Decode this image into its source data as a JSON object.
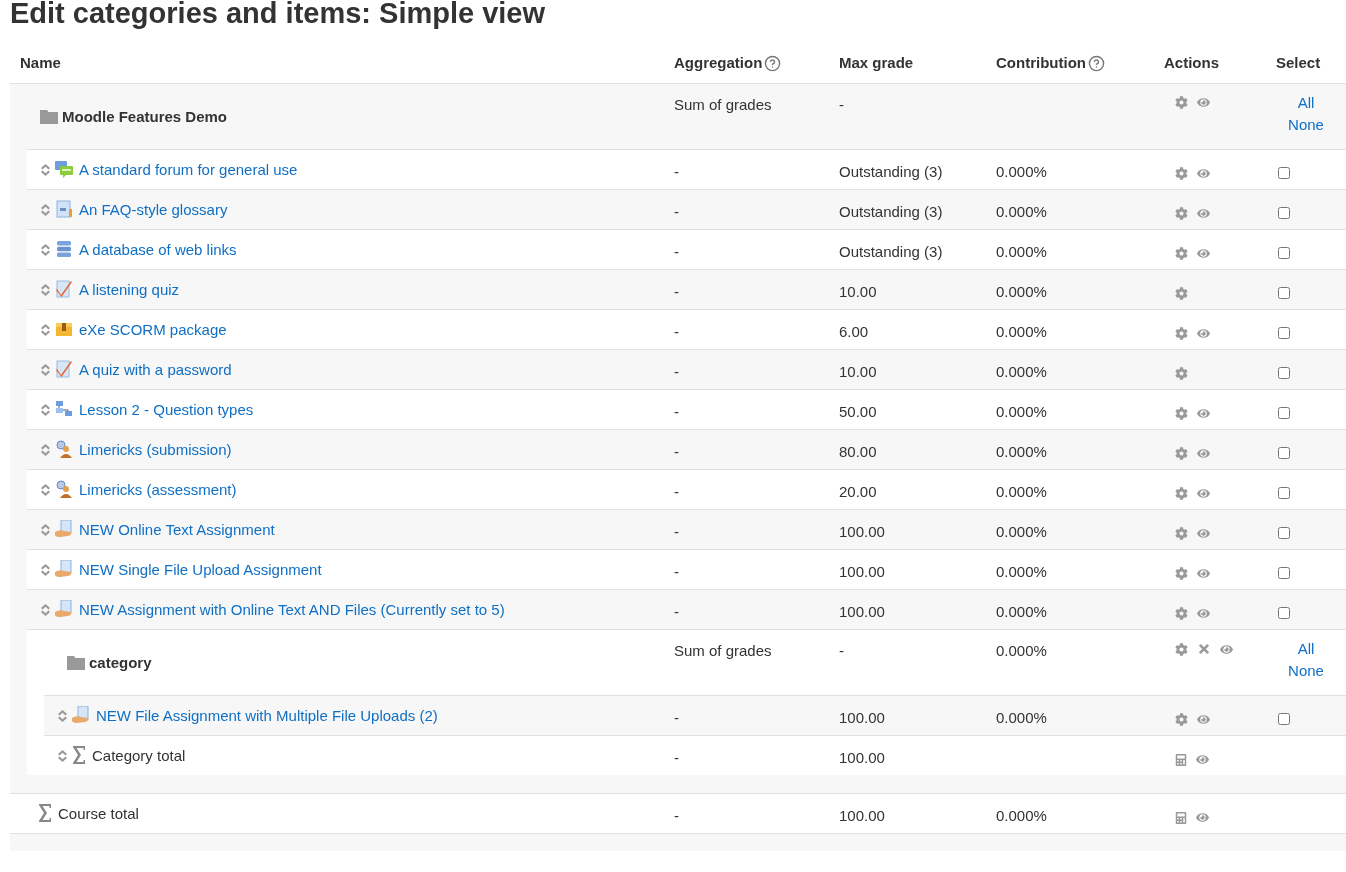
{
  "title": "Edit categories and items: Simple view",
  "columns": [
    {
      "label": "Name",
      "help": false
    },
    {
      "label": "Aggregation",
      "help": true
    },
    {
      "label": "Max grade",
      "help": false
    },
    {
      "label": "Contribution",
      "help": true
    },
    {
      "label": "Actions",
      "help": false
    },
    {
      "label": "Select",
      "help": false
    }
  ],
  "rows": [
    {
      "kind": "category",
      "name": "Moodle Features Demo",
      "aggregation": "Sum of grades",
      "max_grade": "-",
      "actions": [
        {
          "kind": "edit"
        },
        {
          "kind": "show"
        }
      ],
      "select": [
        "All",
        "None"
      ],
      "children": [
        {
          "kind": "item",
          "icon": {
            "kind": "forum"
          },
          "name": "A standard forum for general use",
          "aggregation": "-",
          "max_grade": "Outstanding (3)",
          "contribution": "0.000%",
          "actions": [
            {
              "kind": "edit"
            },
            {
              "kind": "show"
            }
          ],
          "checked": false
        },
        {
          "kind": "item",
          "icon": {
            "kind": "glossary"
          },
          "name": "An FAQ-style glossary",
          "aggregation": "-",
          "max_grade": "Outstanding (3)",
          "contribution": "0.000%",
          "actions": [
            {
              "kind": "edit"
            },
            {
              "kind": "show"
            }
          ],
          "checked": false
        },
        {
          "kind": "item",
          "icon": {
            "kind": "database"
          },
          "name": "A database of web links",
          "aggregation": "-",
          "max_grade": "Outstanding (3)",
          "contribution": "0.000%",
          "actions": [
            {
              "kind": "edit"
            },
            {
              "kind": "show"
            }
          ],
          "checked": false
        },
        {
          "kind": "item",
          "icon": {
            "kind": "quiz"
          },
          "name": "A listening quiz",
          "aggregation": "-",
          "max_grade": "10.00",
          "contribution": "0.000%",
          "actions": [
            {
              "kind": "edit"
            }
          ],
          "checked": false
        },
        {
          "kind": "item",
          "icon": {
            "kind": "scorm"
          },
          "name": "eXe SCORM package",
          "aggregation": "-",
          "max_grade": "6.00",
          "contribution": "0.000%",
          "actions": [
            {
              "kind": "edit"
            },
            {
              "kind": "show"
            }
          ],
          "checked": false
        },
        {
          "kind": "item",
          "icon": {
            "kind": "quiz"
          },
          "name": "A quiz with a password",
          "aggregation": "-",
          "max_grade": "10.00",
          "contribution": "0.000%",
          "actions": [
            {
              "kind": "edit"
            }
          ],
          "checked": false
        },
        {
          "kind": "item",
          "icon": {
            "kind": "lesson"
          },
          "name": "Lesson 2 - Question types",
          "aggregation": "-",
          "max_grade": "50.00",
          "contribution": "0.000%",
          "actions": [
            {
              "kind": "edit"
            },
            {
              "kind": "show"
            }
          ],
          "checked": false
        },
        {
          "kind": "item",
          "icon": {
            "kind": "workshop"
          },
          "name": "Limericks (submission)",
          "aggregation": "-",
          "max_grade": "80.00",
          "contribution": "0.000%",
          "actions": [
            {
              "kind": "edit"
            },
            {
              "kind": "show"
            }
          ],
          "checked": false
        },
        {
          "kind": "item",
          "icon": {
            "kind": "workshop"
          },
          "name": "Limericks (assessment)",
          "aggregation": "-",
          "max_grade": "20.00",
          "contribution": "0.000%",
          "actions": [
            {
              "kind": "edit"
            },
            {
              "kind": "show"
            }
          ],
          "checked": false
        },
        {
          "kind": "item",
          "icon": {
            "kind": "assignment"
          },
          "name": "NEW Online Text Assignment",
          "aggregation": "-",
          "max_grade": "100.00",
          "contribution": "0.000%",
          "actions": [
            {
              "kind": "edit"
            },
            {
              "kind": "show"
            }
          ],
          "checked": false
        },
        {
          "kind": "item",
          "icon": {
            "kind": "assignment"
          },
          "name": "NEW Single File Upload Assignment",
          "aggregation": "-",
          "max_grade": "100.00",
          "contribution": "0.000%",
          "actions": [
            {
              "kind": "edit"
            },
            {
              "kind": "show"
            }
          ],
          "checked": false
        },
        {
          "kind": "item",
          "icon": {
            "kind": "assignment"
          },
          "name": "NEW Assignment with Online Text AND Files (Currently set to 5)",
          "aggregation": "-",
          "max_grade": "100.00",
          "contribution": "0.000%",
          "actions": [
            {
              "kind": "edit"
            },
            {
              "kind": "show"
            }
          ],
          "checked": false
        },
        {
          "kind": "category",
          "name": "category",
          "aggregation": "Sum of grades",
          "max_grade": "-",
          "contribution": "0.000%",
          "actions": [
            {
              "kind": "edit"
            },
            {
              "kind": "delete"
            },
            {
              "kind": "show"
            }
          ],
          "select": [
            "All",
            "None"
          ],
          "children": [
            {
              "kind": "item",
              "icon": {
                "kind": "assignment"
              },
              "name": "NEW File Assignment with Multiple File Uploads (2)",
              "aggregation": "-",
              "max_grade": "100.00",
              "contribution": "0.000%",
              "actions": [
                {
                  "kind": "edit"
                },
                {
                  "kind": "show"
                }
              ],
              "checked": false
            },
            {
              "kind": "total",
              "name": "Category total",
              "aggregation": "-",
              "max_grade": "100.00",
              "actions": [
                {
                  "kind": "calculation"
                },
                {
                  "kind": "show"
                }
              ],
              "movable": true
            }
          ]
        }
      ]
    },
    {
      "kind": "total",
      "name": "Course total",
      "aggregation": "-",
      "max_grade": "100.00",
      "contribution": "0.000%",
      "actions": [
        {
          "kind": "calculation"
        },
        {
          "kind": "show"
        }
      ],
      "movable": false
    }
  ]
}
